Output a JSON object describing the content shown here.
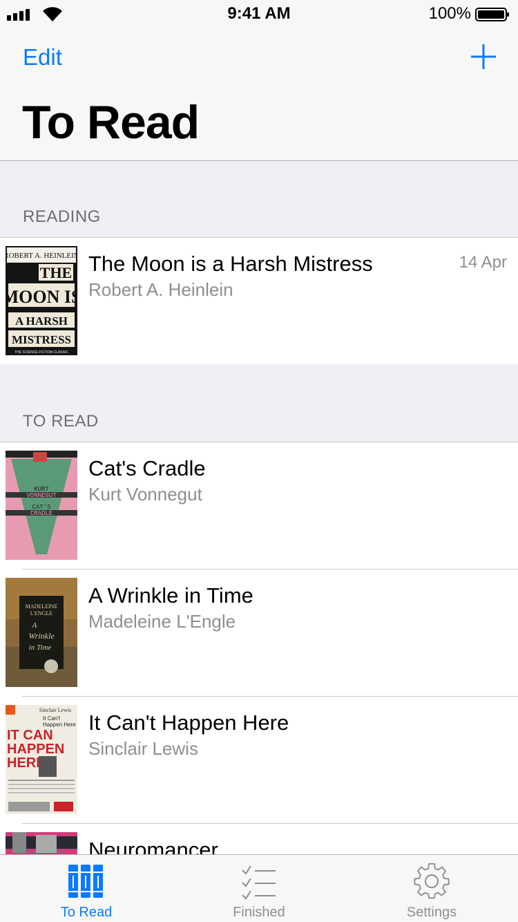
{
  "status_bar": {
    "time": "9:41 AM",
    "battery": "100%"
  },
  "navbar": {
    "edit_label": "Edit",
    "add_icon": "plus-icon",
    "title": "To Read"
  },
  "sections": {
    "reading": {
      "header": "READING",
      "books": [
        {
          "title": "The Moon is a Harsh Mistress",
          "author": "Robert A. Heinlein",
          "date": "14 Apr",
          "cover": {
            "top_text": "ROBERT A. HEINLEIN",
            "lines": [
              "THE",
              "MOON IS",
              "A HARSH",
              "MISTRESS"
            ],
            "tagline": "THE SCIENCE FICTION CLASSIC"
          }
        }
      ]
    },
    "to_read": {
      "header": "TO READ",
      "books": [
        {
          "title": "Cat's Cradle",
          "author": "Kurt Vonnegut",
          "cover": {
            "lines": [
              "KURT",
              "VONNEGUT",
              "CAT'S",
              "CRADLE"
            ]
          }
        },
        {
          "title": "A Wrinkle in Time",
          "author": "Madeleine L'Engle",
          "cover": {
            "lines": [
              "MADELEINE",
              "L'ENGLE",
              "A",
              "Wrinkle",
              "in Time"
            ]
          }
        },
        {
          "title": "It Can't Happen Here",
          "author": "Sinclair Lewis",
          "cover": {
            "lines": [
              "Sinclair Lewis",
              "It Can't",
              "Happen Here",
              "IT CAN",
              "HAPPEN",
              "HERE"
            ]
          }
        },
        {
          "title": "Neuromancer",
          "author": ""
        }
      ]
    }
  },
  "tab_bar": {
    "tabs": [
      {
        "label": "To Read",
        "icon": "books-icon",
        "active": true
      },
      {
        "label": "Finished",
        "icon": "checklist-icon",
        "active": false
      },
      {
        "label": "Settings",
        "icon": "gear-icon",
        "active": false
      }
    ]
  },
  "colors": {
    "accent": "#0a7aff",
    "secondary_text": "#8e8e93",
    "section_background": "#efeff4"
  }
}
